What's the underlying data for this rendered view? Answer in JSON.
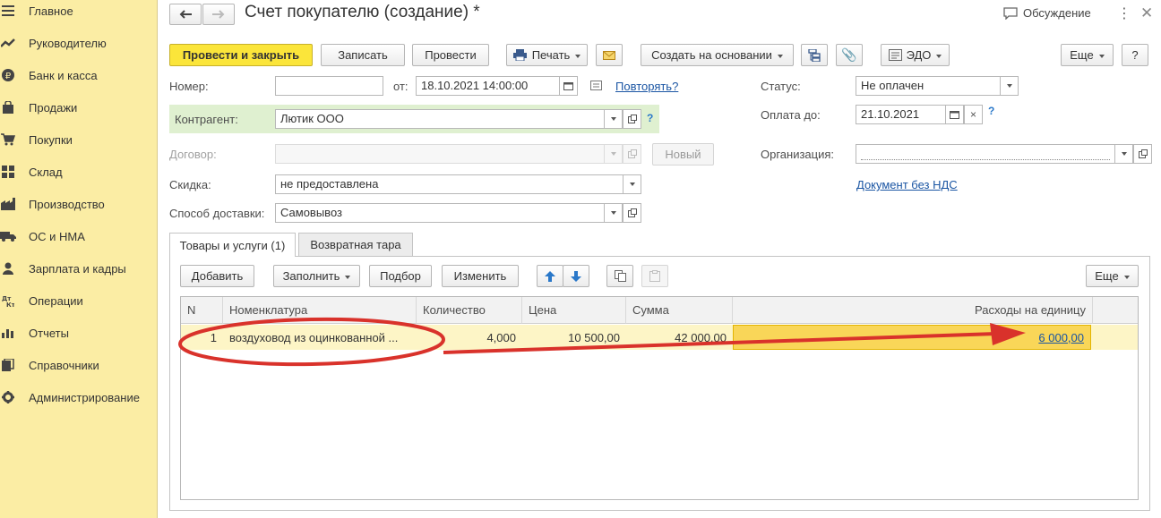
{
  "sidebar": {
    "items": [
      {
        "label": "Главное",
        "icon": "menu-icon"
      },
      {
        "label": "Руководителю",
        "icon": "trend-icon"
      },
      {
        "label": "Банк и касса",
        "icon": "ruble-coin-icon"
      },
      {
        "label": "Продажи",
        "icon": "shopping-bag-icon"
      },
      {
        "label": "Покупки",
        "icon": "cart-icon"
      },
      {
        "label": "Склад",
        "icon": "warehouse-grid-icon"
      },
      {
        "label": "Производство",
        "icon": "factory-icon"
      },
      {
        "label": "ОС и НМА",
        "icon": "truck-icon"
      },
      {
        "label": "Зарплата и кадры",
        "icon": "person-icon"
      },
      {
        "label": "Операции",
        "icon": "dt-kt-icon"
      },
      {
        "label": "Отчеты",
        "icon": "bar-chart-icon"
      },
      {
        "label": "Справочники",
        "icon": "books-icon"
      },
      {
        "label": "Администрирование",
        "icon": "gear-icon"
      }
    ]
  },
  "header": {
    "title": "Счет покупателю (создание) *",
    "discussion": "Обсуждение"
  },
  "toolbar": {
    "post_close": "Провести и закрыть",
    "save": "Записать",
    "post": "Провести",
    "print": "Печать",
    "create_based": "Создать на основании",
    "edo": "ЭДО",
    "more": "Еще",
    "help": "?"
  },
  "form": {
    "number_label": "Номер:",
    "number_value": "",
    "from_label": "от:",
    "date_value": "18.10.2021 14:00:00",
    "repeat_link": "Повторять?",
    "status_label": "Статус:",
    "status_value": "Не оплачен",
    "counterparty_label": "Контрагент:",
    "counterparty_value": "Лютик ООО",
    "pay_until_label": "Оплата до:",
    "pay_until_value": "21.10.2021",
    "contract_label": "Договор:",
    "contract_value": "",
    "new_button": "Новый",
    "organization_label": "Организация:",
    "organization_value": "",
    "discount_label": "Скидка:",
    "discount_value": "не предоставлена",
    "no_vat_link": "Документ без НДС",
    "delivery_label": "Способ доставки:",
    "delivery_value": "Самовывоз",
    "help_mark": "?",
    "clear_mark": "×"
  },
  "tabs": [
    {
      "label": "Товары и услуги (1)",
      "active": true
    },
    {
      "label": "Возвратная тара",
      "active": false
    }
  ],
  "table_toolbar": {
    "add": "Добавить",
    "fill": "Заполнить",
    "pick": "Подбор",
    "change": "Изменить",
    "more": "Еще"
  },
  "table": {
    "columns": [
      "N",
      "Номенклатура",
      "Количество",
      "Цена",
      "Сумма",
      "Расходы на единицу"
    ],
    "rows": [
      {
        "n": "1",
        "name": "воздуховод из оцинкованной ...",
        "qty": "4,000",
        "price": "10 500,00",
        "sum": "42 000,00",
        "cost_per_unit": "6 000,00"
      }
    ]
  },
  "annotation": {
    "color": "#d9322b"
  },
  "colors": {
    "sidebar": "#fbeda4",
    "primary_button": "#fbe53a",
    "row_highlight": "#fdf5c6",
    "cell_selected": "#f9d658",
    "link": "#1a55a3",
    "counterparty_bg": "#dff0d0"
  }
}
